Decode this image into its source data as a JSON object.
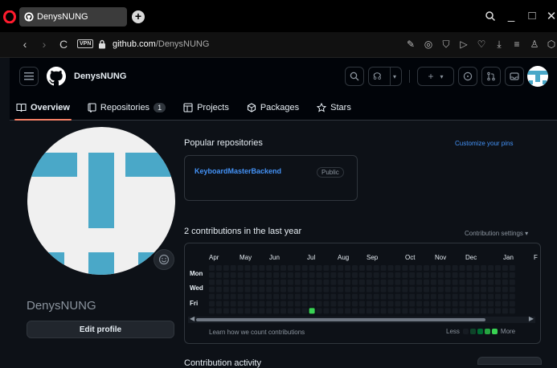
{
  "browser": {
    "tab_title": "DenysNUNG",
    "url_domain": "github.com",
    "url_path": "/DenysNUNG",
    "vpn_label": "VPN"
  },
  "github": {
    "owner": "DenysNUNG",
    "nav": [
      {
        "label": "Overview"
      },
      {
        "label": "Repositories",
        "count": "1"
      },
      {
        "label": "Projects"
      },
      {
        "label": "Packages"
      },
      {
        "label": "Stars"
      }
    ]
  },
  "profile": {
    "username": "DenysNUNG",
    "edit_label": "Edit profile"
  },
  "popular": {
    "title": "Popular repositories",
    "customize": "Customize your pins",
    "repo_name": "KeyboardMasterBackend",
    "repo_visibility": "Public"
  },
  "contributions": {
    "title": "2 contributions in the last year",
    "settings_label": "Contribution settings",
    "months": [
      "Apr",
      "May",
      "Jun",
      "Jul",
      "Aug",
      "Sep",
      "Oct",
      "Nov",
      "Dec",
      "Jan",
      "F"
    ],
    "days": [
      "Mon",
      "Wed",
      "Fri"
    ],
    "learn_link": "Learn how we count contributions",
    "less": "Less",
    "more": "More",
    "active_cell": {
      "week": 14,
      "day": 6
    }
  },
  "activity": {
    "title": "Contribution activity"
  },
  "colors": {
    "accent": "#f78166",
    "link": "#4493f8",
    "contrib_empty": "#161b22",
    "contrib_level": [
      "#0e4429",
      "#006d32",
      "#26a641",
      "#39d353"
    ]
  }
}
